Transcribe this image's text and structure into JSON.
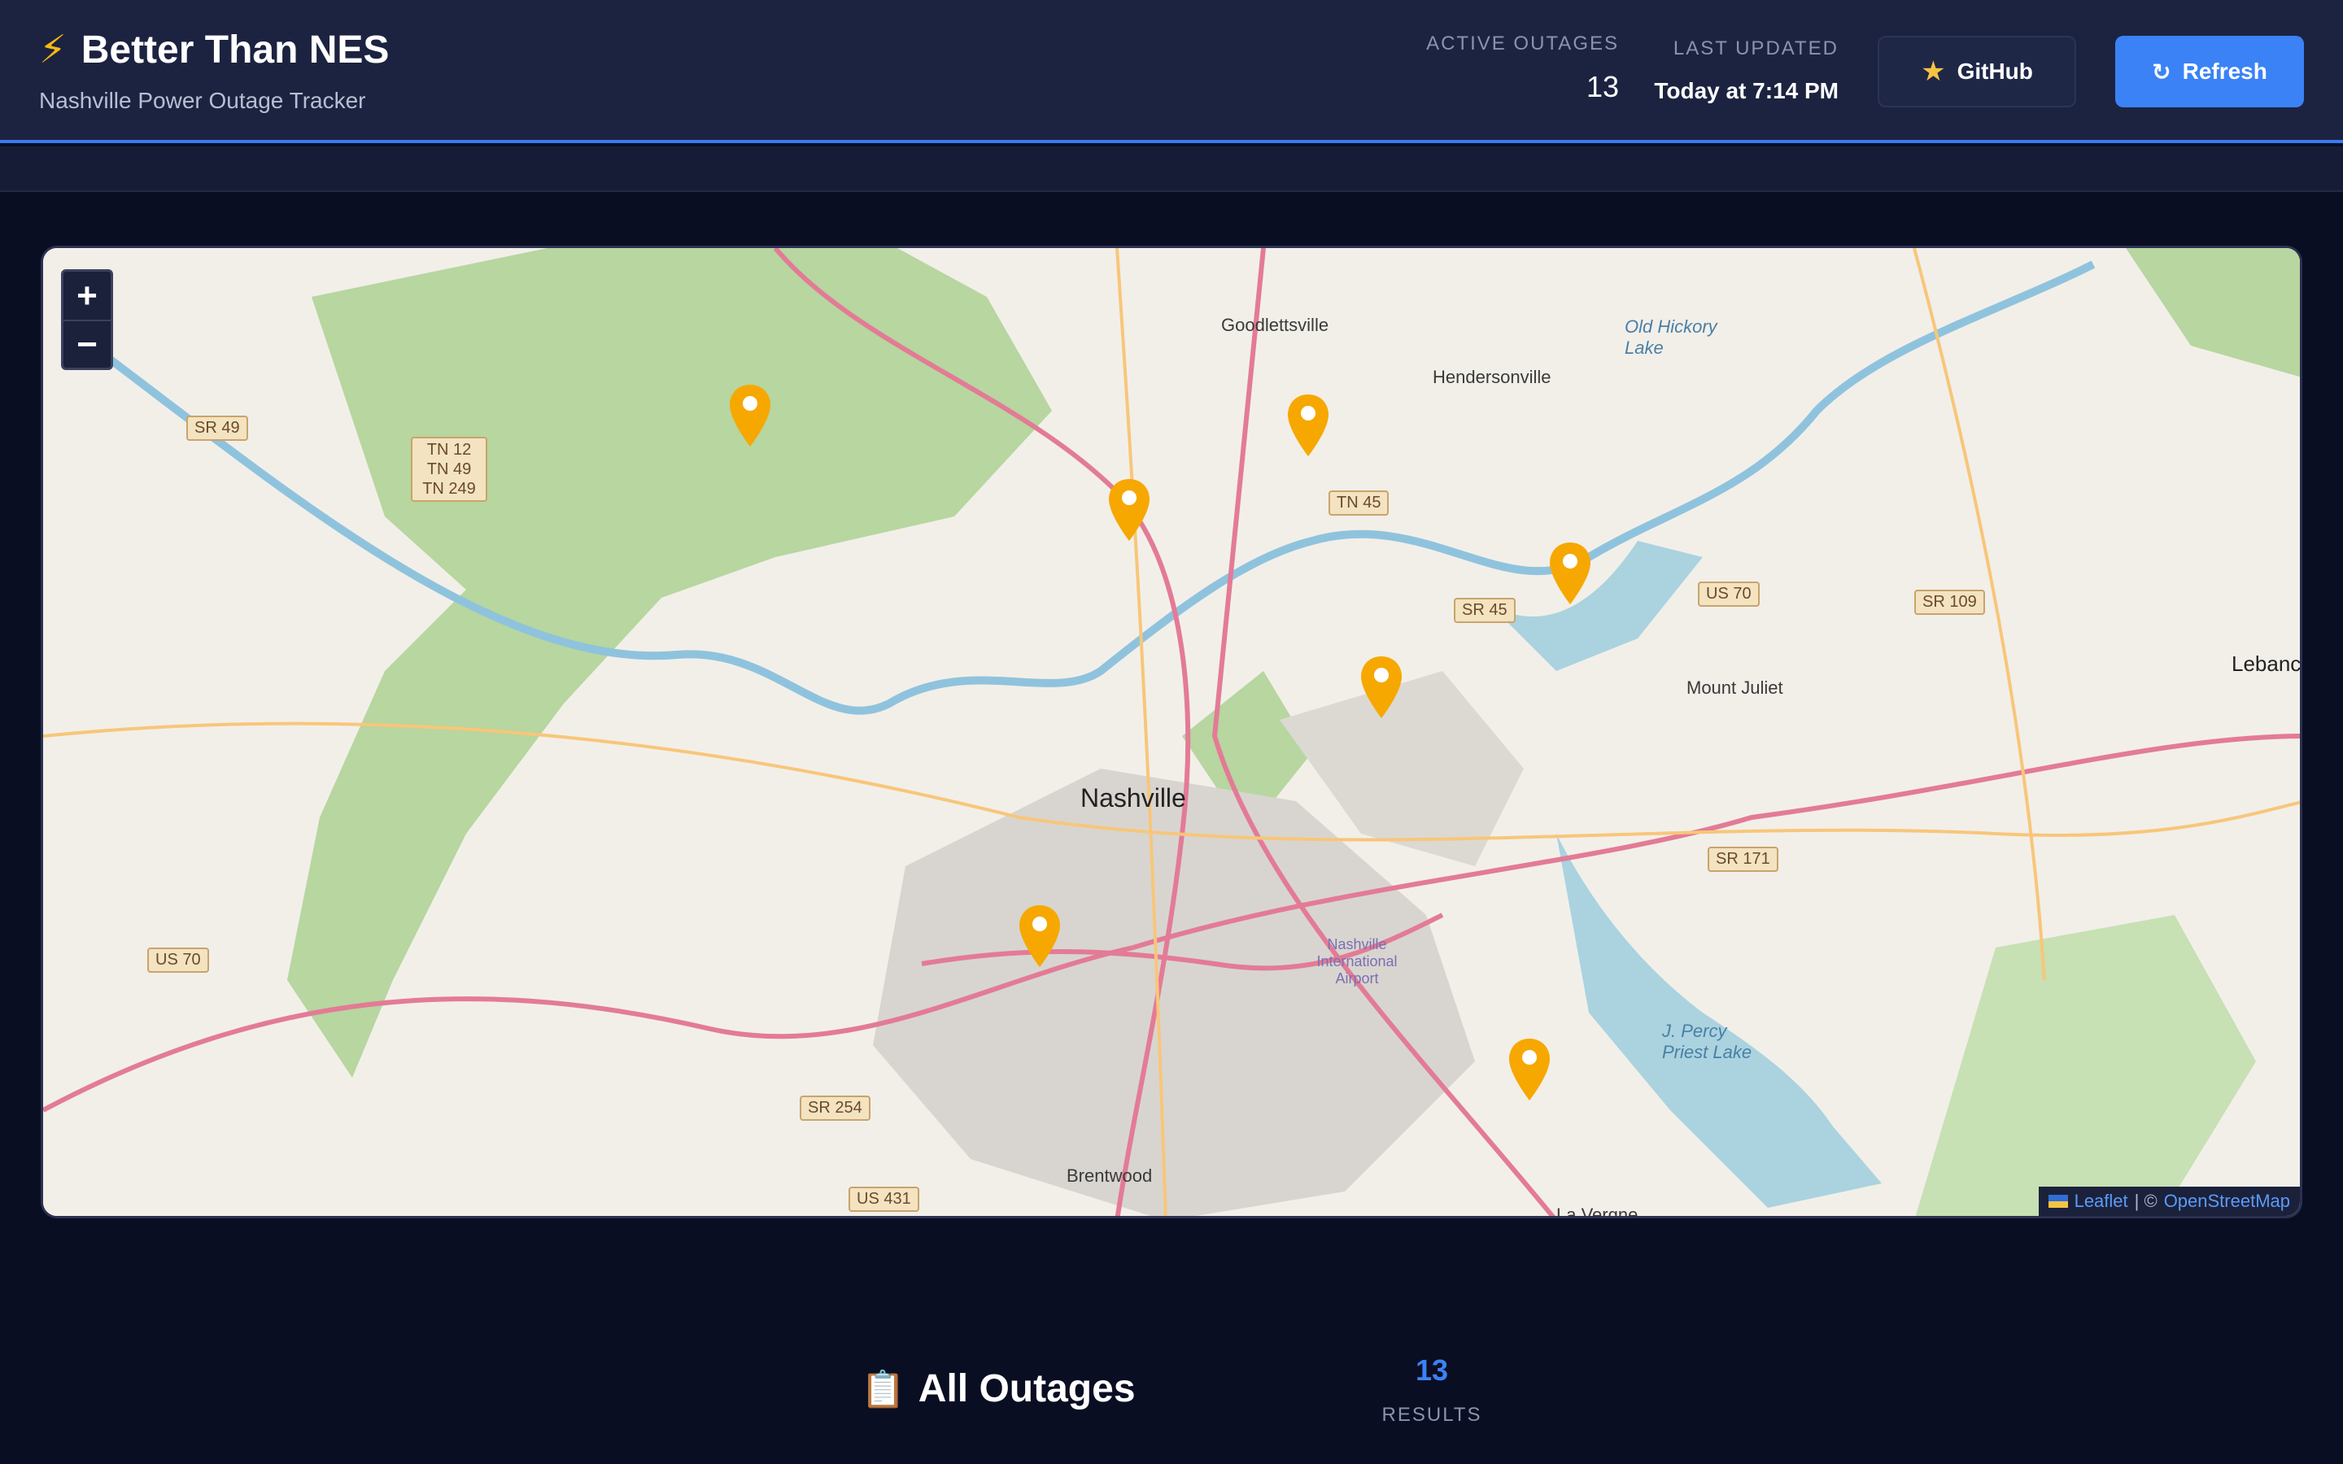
{
  "header": {
    "title": "Better Than NES",
    "subtitle": "Nashville Power Outage Tracker",
    "active_outages_label": "ACTIVE OUTAGES",
    "active_outages_value": "13",
    "last_updated_label": "LAST UPDATED",
    "last_updated_value": "Today at 7:14 PM",
    "github_label": "GitHub",
    "refresh_label": "Refresh"
  },
  "map": {
    "zoom_in": "+",
    "zoom_out": "−",
    "attribution": {
      "leaflet": "Leaflet",
      "sep": "| ©",
      "osm": "OpenStreetMap"
    },
    "places": {
      "nashville": "Nashville",
      "goodlettsville": "Goodlettsville",
      "hendersonville": "Hendersonville",
      "mount_juliet": "Mount Juliet",
      "brentwood": "Brentwood",
      "la_vergne": "La Vergne",
      "old_hickory_lake": "Old Hickory Lake",
      "percy_priest_lake": "J. Percy Priest Lake",
      "airport": "Nashville International Airport",
      "lebanon": "Lebanc"
    },
    "shields": [
      "SR 49",
      "TN 12 TN 49 TN 249",
      "TN 45",
      "SR 45",
      "US 70",
      "SR 109",
      "SR 171",
      "SR 254",
      "US 431",
      "US 70"
    ],
    "marker_color": "#f6a800"
  },
  "outages": {
    "title": "All Outages",
    "results_count": "13",
    "results_label": "RESULTS"
  }
}
